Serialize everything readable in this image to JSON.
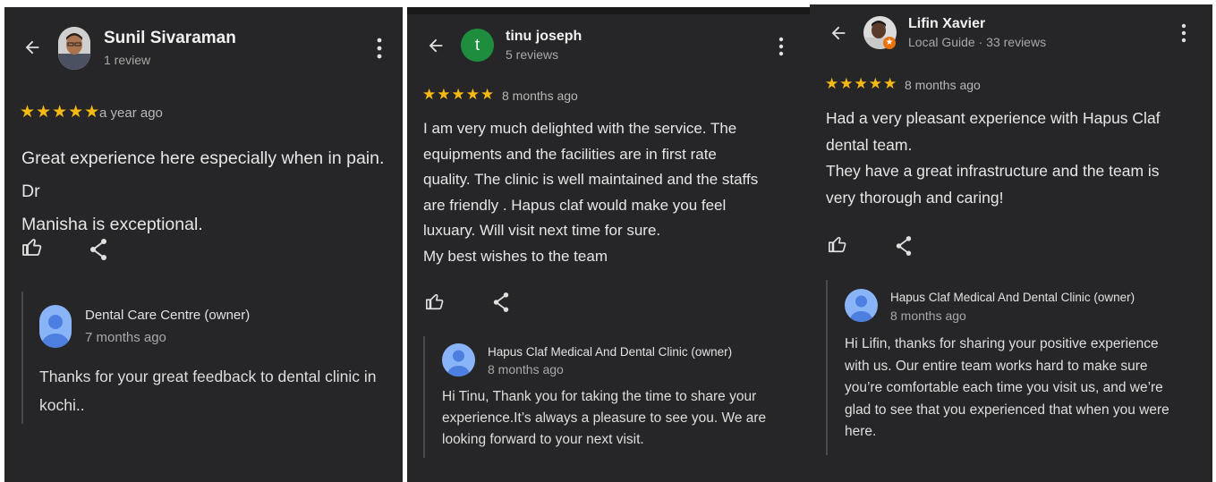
{
  "reviews": [
    {
      "author": "Sunil Sivaraman",
      "author_meta": "1 review",
      "stars": "★★★★★",
      "time": "a year ago",
      "text": "Great experience here especially when in pain. Dr\nManisha is exceptional.",
      "reply": {
        "owner": "Dental Care Centre (owner)",
        "time": "7 months ago",
        "text": "Thanks for your great feedback to dental clinic in\nkochi.."
      }
    },
    {
      "author": "tinu joseph",
      "author_initial": "t",
      "author_meta": "5 reviews",
      "stars": "★★★★★",
      "time": "8 months ago",
      "text": "I am very much delighted with the service. The\nequipments and the facilities are in first rate\nquality. The clinic is well maintained and the staffs\nare friendly . Hapus claf would make you feel\nluxuary. Will visit next time for sure.\nMy best wishes to the team",
      "reply": {
        "owner": "Hapus Claf Medical And Dental Clinic (owner)",
        "time": "8 months ago",
        "text": "Hi Tinu, Thank you for taking the time to share your\nexperience.It’s always a pleasure to see you. We are\nlooking forward to your next visit."
      }
    },
    {
      "author": "Lifin Xavier",
      "author_meta": "Local Guide · 33 reviews",
      "stars": "★★★★★",
      "time": "8 months ago",
      "text": "Had a very pleasant experience with Hapus Claf\ndental team.\nThey have a great infrastructure and the team is\nvery thorough and caring!",
      "reply": {
        "owner": "Hapus Claf Medical And Dental Clinic (owner)",
        "time": "8 months ago",
        "text": "Hi Lifin, thanks for sharing your positive experience\nwith us. Our entire team works hard to make sure\nyou’re comfortable each time you visit us, and we’re\nglad to see that you experienced that when you were\nhere."
      }
    }
  ],
  "icons": {
    "back": "arrow-back-icon",
    "more": "more-vert-icon",
    "like": "thumb-up-icon",
    "share": "share-icon",
    "owner_avatar": "person-avatar-icon"
  },
  "colors": {
    "background": "#262628",
    "stars": "#f5b915",
    "owner_avatar": "#8ab4f8",
    "tinu_avatar": "#1e8e3e"
  }
}
